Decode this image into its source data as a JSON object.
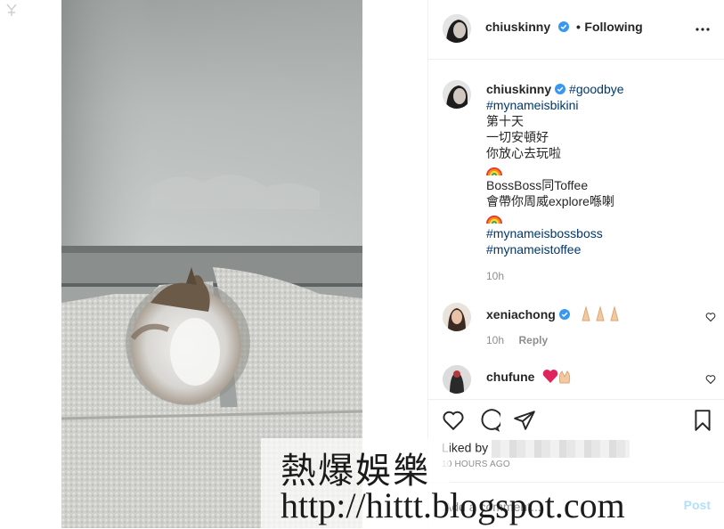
{
  "header": {
    "username": "chiuskinny",
    "separator": "•",
    "follow_status": "Following"
  },
  "caption": {
    "username": "chiuskinny",
    "tag_goodbye": "#goodbye",
    "tag_bikini": "#mynameisbikini",
    "line1": "第十天",
    "line2": "一切安頓好",
    "line3": "你放心去玩啦",
    "line4": "BossBoss同Toffee",
    "line5": "會帶你周威explore喺喇",
    "tag_bossboss": "#mynameisbossboss",
    "tag_toffee": "#mynameistoffee",
    "time": "10h"
  },
  "comments": [
    {
      "username": "xeniachong",
      "time": "10h",
      "reply": "Reply"
    },
    {
      "username": "chufune"
    }
  ],
  "likes": {
    "label": "Liked by"
  },
  "post_time": "10 HOURS AGO",
  "add_comment": {
    "placeholder": "Add a comment...",
    "post_label": "Post"
  },
  "watermark": {
    "title": "熱爆娛樂",
    "url": "http://hittt.blogspot.com"
  },
  "colors": {
    "verified": "#3897f0",
    "hashtag": "#00376b",
    "post_disabled": "#b2dffc",
    "muted": "#8e8e8e"
  },
  "icons": [
    "more-icon",
    "heart-icon",
    "comment-icon",
    "share-icon",
    "bookmark-icon",
    "verified-icon"
  ]
}
